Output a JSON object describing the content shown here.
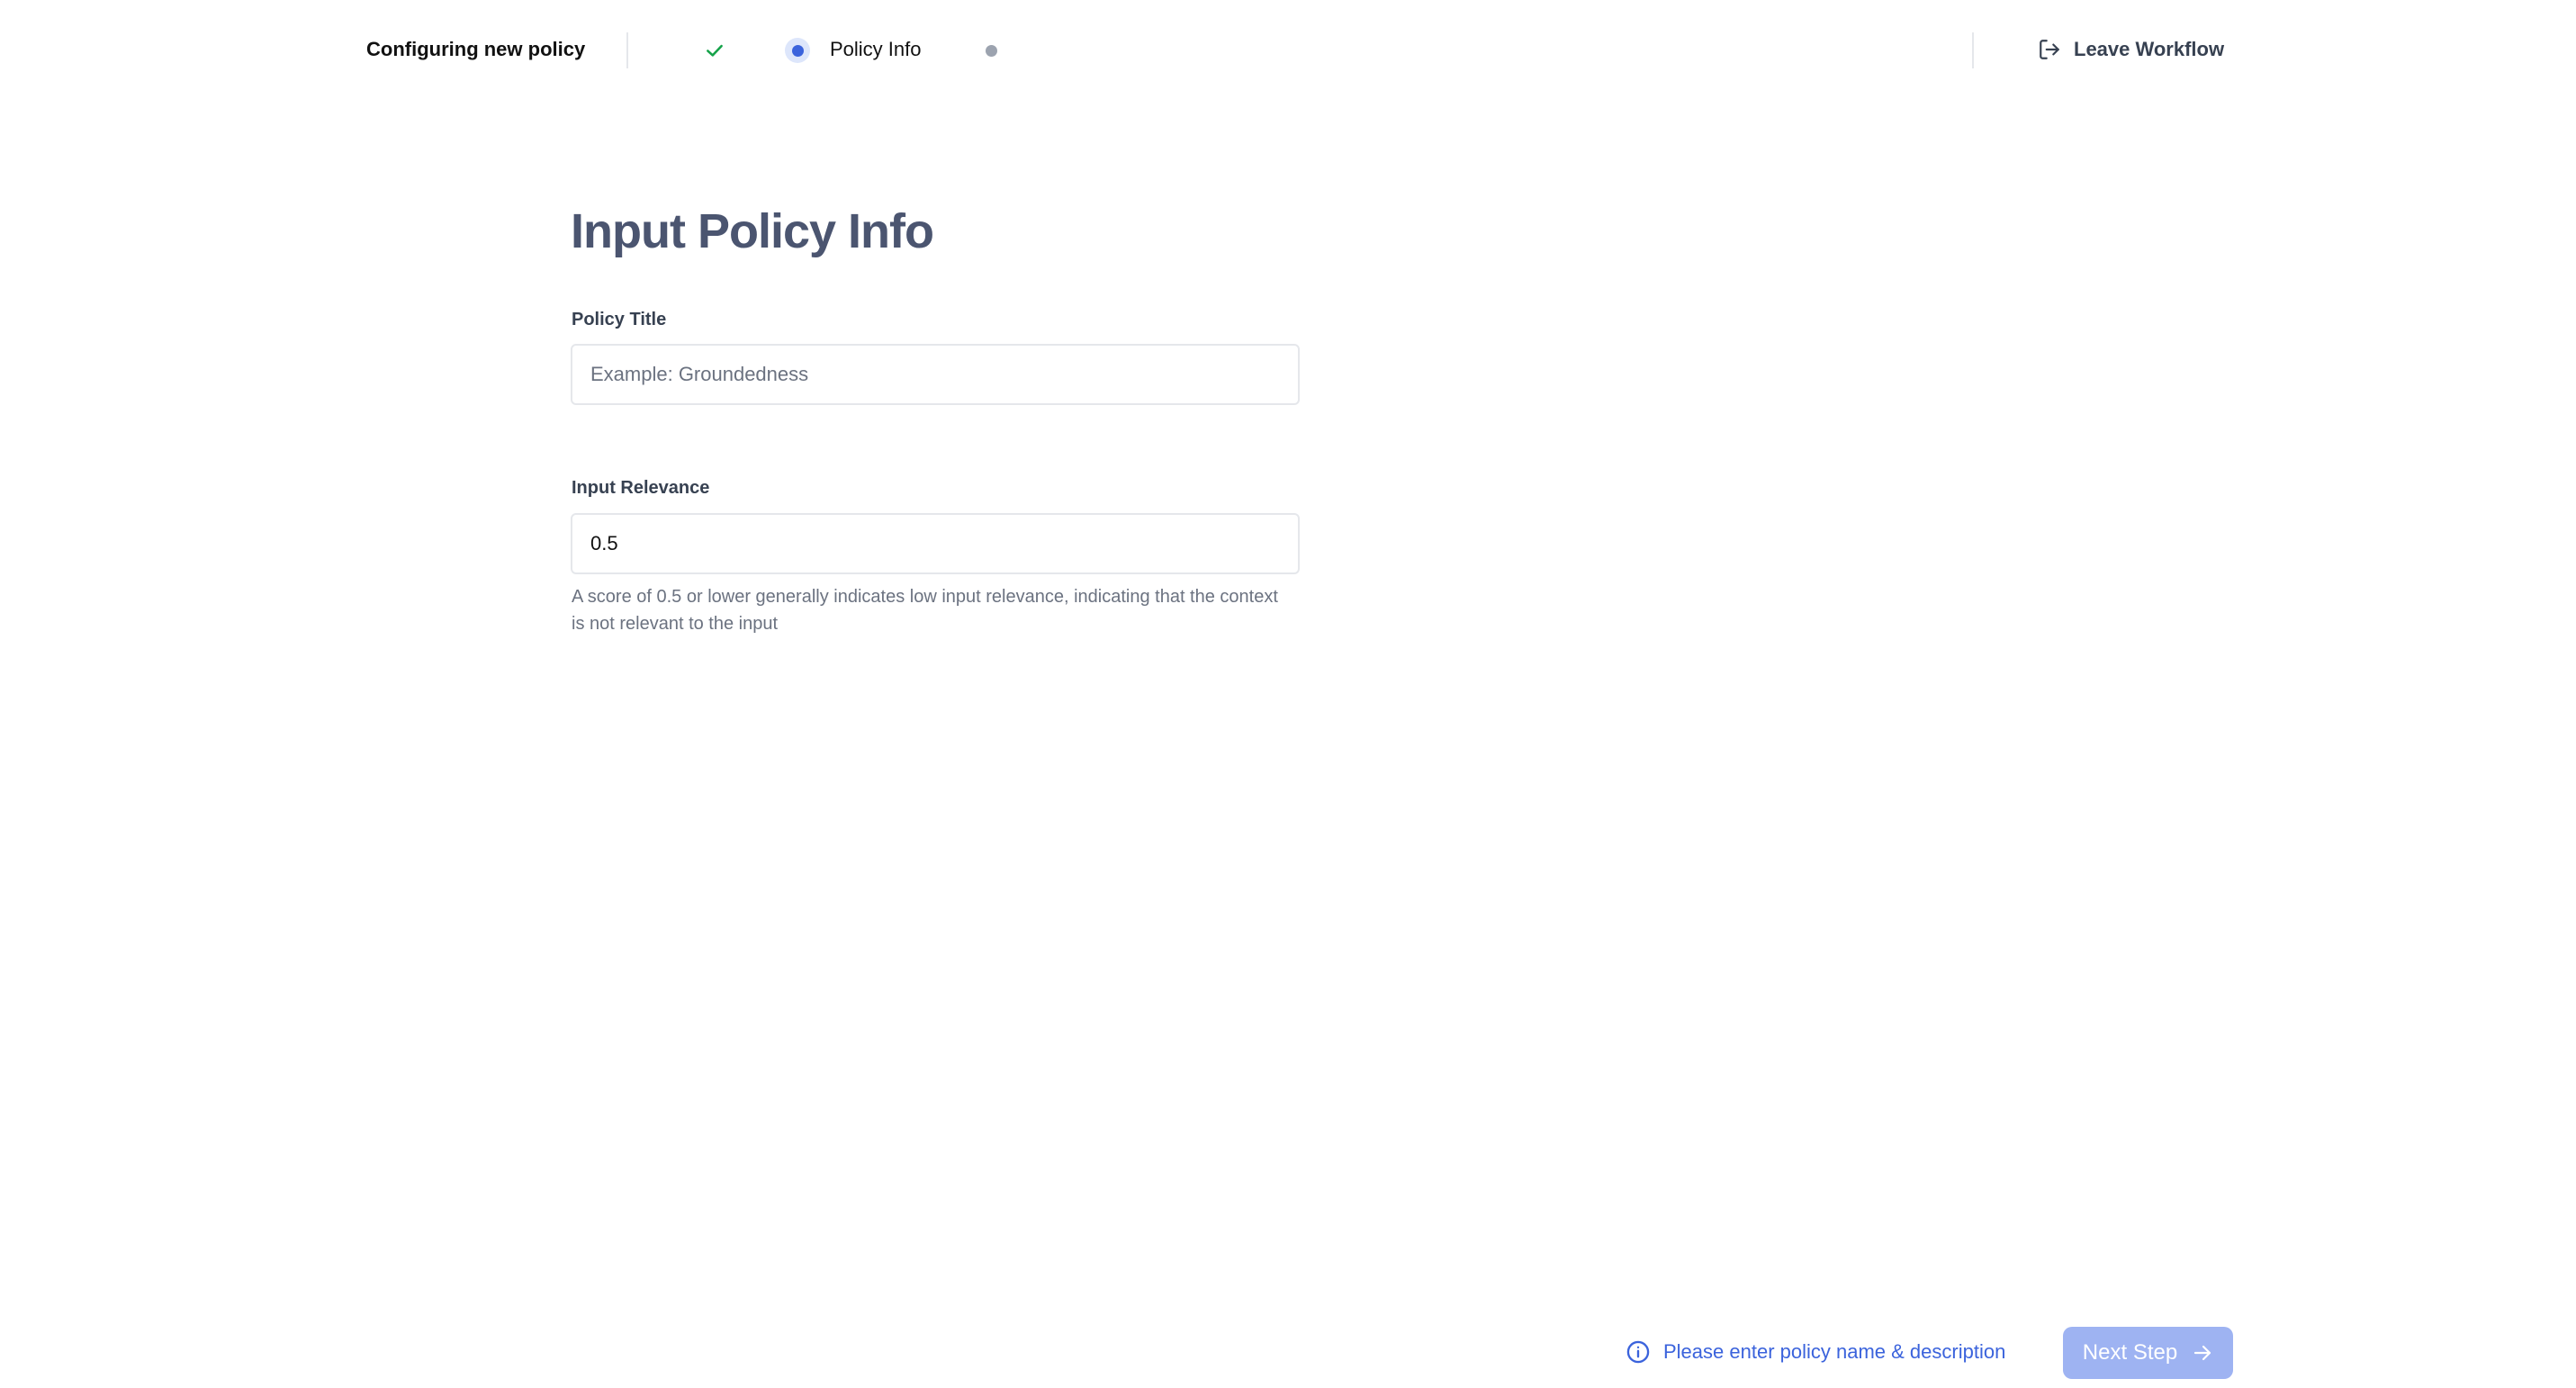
{
  "header": {
    "workflow_title": "Configuring new policy",
    "steps": [
      {
        "status": "completed",
        "icon": "check-icon",
        "label": ""
      },
      {
        "status": "current",
        "label": "Policy Info"
      },
      {
        "status": "pending",
        "label": ""
      }
    ],
    "leave_label": "Leave Workflow",
    "leave_icon": "exit-icon"
  },
  "form": {
    "heading": "Input Policy Info",
    "policy_title": {
      "label": "Policy Title",
      "placeholder": "Example: Groundedness",
      "value": ""
    },
    "input_relevance": {
      "label": "Input Relevance",
      "value": "0.5",
      "helper": "A score of 0.5 or lower generally indicates low input relevance, indicating that the context is not relevant to the input"
    }
  },
  "footer": {
    "info_icon": "info-icon",
    "info_text": "Please enter policy name & description",
    "next_label": "Next Step",
    "next_icon": "arrow-right-icon",
    "next_disabled": true
  },
  "colors": {
    "accent": "#3b63dc",
    "accent_light": "#9eb3f2",
    "success": "#16a34a",
    "heading": "#4b5570",
    "muted": "#6b7280"
  }
}
